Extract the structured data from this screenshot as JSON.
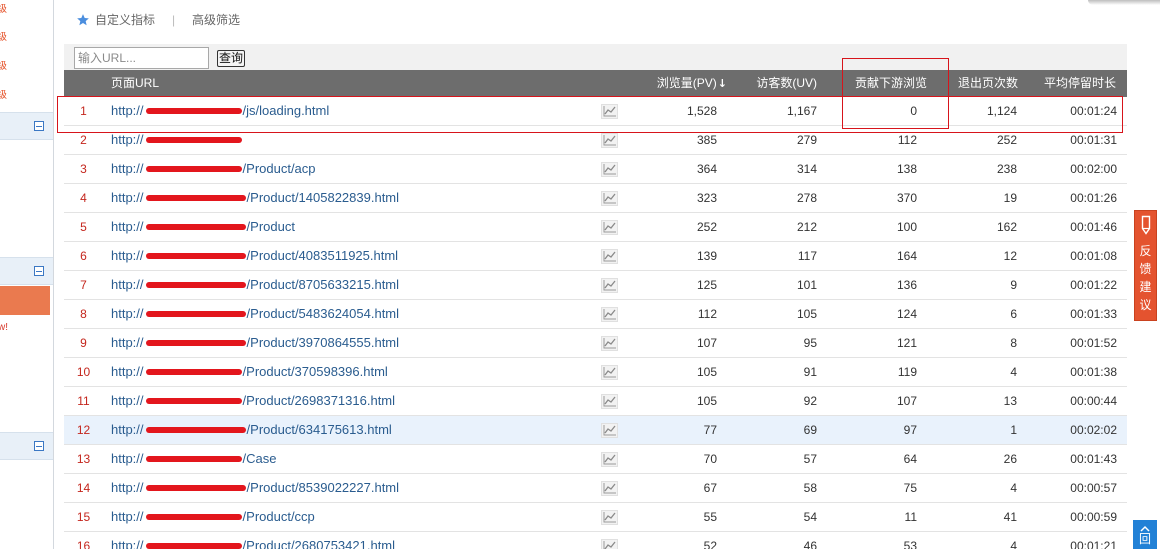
{
  "sidebar": {
    "badges": [
      "级",
      "级",
      "级",
      "级"
    ],
    "note": "w!"
  },
  "toolbar": {
    "custom_metrics": "自定义指标",
    "separator": "|",
    "advanced_filter": "高级筛选"
  },
  "search": {
    "placeholder": "输入URL...",
    "button_label": "查询"
  },
  "table": {
    "columns": {
      "url": "页面URL",
      "pv": "浏览量(PV)",
      "pv_sort_arrow": "↓",
      "uv": "访客数(UV)",
      "downstream": "贡献下游浏览",
      "exits": "退出页次数",
      "avg_time": "平均停留时长"
    },
    "rows": [
      {
        "rank": "1",
        "url_prefix": "http://",
        "url_path": "/js/loading.html",
        "pv": "1,528",
        "uv": "1,167",
        "downstream": "0",
        "exits": "1,124",
        "avg_time": "00:01:24"
      },
      {
        "rank": "2",
        "url_prefix": "http://",
        "url_path": "",
        "pv": "385",
        "uv": "279",
        "downstream": "112",
        "exits": "252",
        "avg_time": "00:01:31"
      },
      {
        "rank": "3",
        "url_prefix": "http://",
        "url_path": "/Product/acp",
        "pv": "364",
        "uv": "314",
        "downstream": "138",
        "exits": "238",
        "avg_time": "00:02:00"
      },
      {
        "rank": "4",
        "url_prefix": "http://",
        "url_path": "/Product/1405822839.html",
        "pv": "323",
        "uv": "278",
        "downstream": "370",
        "exits": "19",
        "avg_time": "00:01:26"
      },
      {
        "rank": "5",
        "url_prefix": "http://",
        "url_path": "/Product",
        "pv": "252",
        "uv": "212",
        "downstream": "100",
        "exits": "162",
        "avg_time": "00:01:46"
      },
      {
        "rank": "6",
        "url_prefix": "http://",
        "url_path": "/Product/4083511925.html",
        "pv": "139",
        "uv": "117",
        "downstream": "164",
        "exits": "12",
        "avg_time": "00:01:08"
      },
      {
        "rank": "7",
        "url_prefix": "http://",
        "url_path": "/Product/8705633215.html",
        "pv": "125",
        "uv": "101",
        "downstream": "136",
        "exits": "9",
        "avg_time": "00:01:22"
      },
      {
        "rank": "8",
        "url_prefix": "http://",
        "url_path": "/Product/5483624054.html",
        "pv": "112",
        "uv": "105",
        "downstream": "124",
        "exits": "6",
        "avg_time": "00:01:33"
      },
      {
        "rank": "9",
        "url_prefix": "http://",
        "url_path": "/Product/3970864555.html",
        "pv": "107",
        "uv": "95",
        "downstream": "121",
        "exits": "8",
        "avg_time": "00:01:52"
      },
      {
        "rank": "10",
        "url_prefix": "http://",
        "url_path": "/Product/370598396.html",
        "pv": "105",
        "uv": "91",
        "downstream": "119",
        "exits": "4",
        "avg_time": "00:01:38"
      },
      {
        "rank": "11",
        "url_prefix": "http://",
        "url_path": "/Product/2698371316.html",
        "pv": "105",
        "uv": "92",
        "downstream": "107",
        "exits": "13",
        "avg_time": "00:00:44"
      },
      {
        "rank": "12",
        "url_prefix": "http://",
        "url_path": "/Product/634175613.html",
        "pv": "77",
        "uv": "69",
        "downstream": "97",
        "exits": "1",
        "avg_time": "00:02:02"
      },
      {
        "rank": "13",
        "url_prefix": "http://",
        "url_path": "/Case",
        "pv": "70",
        "uv": "57",
        "downstream": "64",
        "exits": "26",
        "avg_time": "00:01:43"
      },
      {
        "rank": "14",
        "url_prefix": "http://",
        "url_path": "/Product/8539022227.html",
        "pv": "67",
        "uv": "58",
        "downstream": "75",
        "exits": "4",
        "avg_time": "00:00:57"
      },
      {
        "rank": "15",
        "url_prefix": "http://",
        "url_path": "/Product/ccp",
        "pv": "55",
        "uv": "54",
        "downstream": "11",
        "exits": "41",
        "avg_time": "00:00:59"
      },
      {
        "rank": "16",
        "url_prefix": "http://",
        "url_path": "/Product/2680753421.html",
        "pv": "52",
        "uv": "46",
        "downstream": "53",
        "exits": "4",
        "avg_time": "00:01:21"
      }
    ]
  },
  "feedback": {
    "chars": [
      "反",
      "馈",
      "建",
      "议"
    ]
  },
  "back_to_top": {
    "label": "回"
  },
  "icons": {
    "toolbar_star": "star-icon",
    "sort": "sort-desc-icon",
    "row_trend": "line-chart-icon",
    "sidebar_collapse": "minus-square-icon",
    "feedback": "pencil-icon",
    "back_to_top": "arrow-up-icon"
  },
  "colors": {
    "header_bg": "#6d6d6d",
    "rank_text": "#c4261d",
    "link_text": "#2a5c8f",
    "hover_row_bg": "#e9f2fc",
    "sidebar_active": "#ea7a4f",
    "feedback_bg": "#e4532f",
    "back_to_top_bg": "#2281d6",
    "annotation_red": "#d7141b",
    "redaction_red": "#e3161d"
  }
}
